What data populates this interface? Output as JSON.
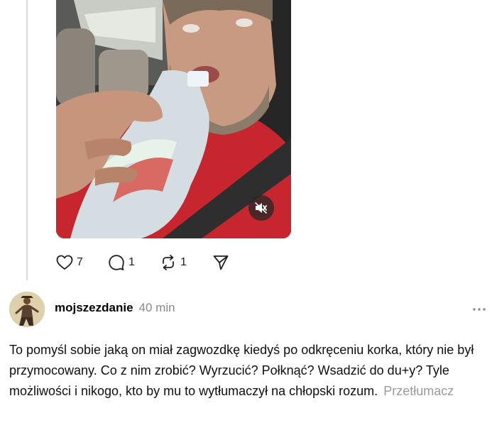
{
  "media": {
    "type": "video-thumbnail",
    "mute_icon": "speaker-muted-icon"
  },
  "actions": {
    "like": {
      "icon": "heart-icon",
      "count": "7"
    },
    "reply": {
      "icon": "comment-bubble-icon",
      "count": "1"
    },
    "repost": {
      "icon": "repost-arrows-icon",
      "count": "1"
    },
    "share": {
      "icon": "send-paper-plane-icon"
    }
  },
  "post": {
    "avatar_icon": "user-avatar",
    "username": "mojszezdanie",
    "timestamp": "40 min",
    "more_icon": "more-horizontal-icon",
    "body": "To pomyśl sobie jaką on miał zagwozdkę kiedyś po odkręceniu korka, który nie był przymocowany. Co z nim zrobić? Wyrzucić? Połknąć? Wsadzić do du+y? Tyle możliwości i nikogo, kto by mu to wytłumaczył na chłopski rozum.",
    "translate_label": "Przetłumacz"
  },
  "colors": {
    "text": "#0f0f0f",
    "muted": "#8a8a8a",
    "thread_line": "#d9d9d9"
  }
}
